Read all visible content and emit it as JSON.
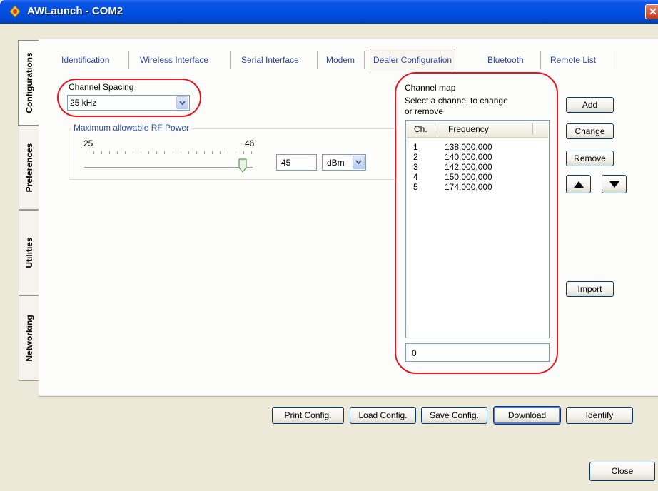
{
  "window": {
    "title": "AWLaunch - COM2",
    "close_glyph": "✕"
  },
  "side_tabs": [
    "Configurations",
    "Preferences",
    "Utilities",
    "Networking"
  ],
  "tabs": [
    "Identification",
    "Wireless Interface",
    "Serial Interface",
    "Modem",
    "Dealer Configuration",
    "Bluetooth",
    "Remote List"
  ],
  "active_tab": "Dealer Configuration",
  "channel_spacing": {
    "label": "Channel Spacing",
    "value": "25 kHz"
  },
  "rf_power": {
    "group_title": "Maximum allowable RF Power",
    "min_label": "25",
    "max_label": "46",
    "value": "45",
    "unit": "dBm",
    "slider_level": 0.95
  },
  "channel_map": {
    "title": "Channel map",
    "instruction_line1": "Select a channel to change",
    "instruction_line2": "or remove",
    "columns": [
      "Ch.",
      "Frequency"
    ],
    "rows": [
      {
        "ch": "1",
        "freq": "138,000,000"
      },
      {
        "ch": "2",
        "freq": "140,000,000"
      },
      {
        "ch": "3",
        "freq": "142,000,000"
      },
      {
        "ch": "4",
        "freq": "150,000,000"
      },
      {
        "ch": "5",
        "freq": "174,000,000"
      }
    ],
    "input_value": "0"
  },
  "buttons": {
    "add": "Add",
    "change": "Change",
    "remove": "Remove",
    "import": "Import",
    "print_config": "Print Config.",
    "load_config": "Load Config.",
    "save_config": "Save Config.",
    "download": "Download",
    "identify": "Identify",
    "close": "Close"
  },
  "colors": {
    "title_bar": "#0050df",
    "highlight": "#e8131c",
    "tab_text": "#30459a",
    "group_title": "#2b4fa8"
  }
}
